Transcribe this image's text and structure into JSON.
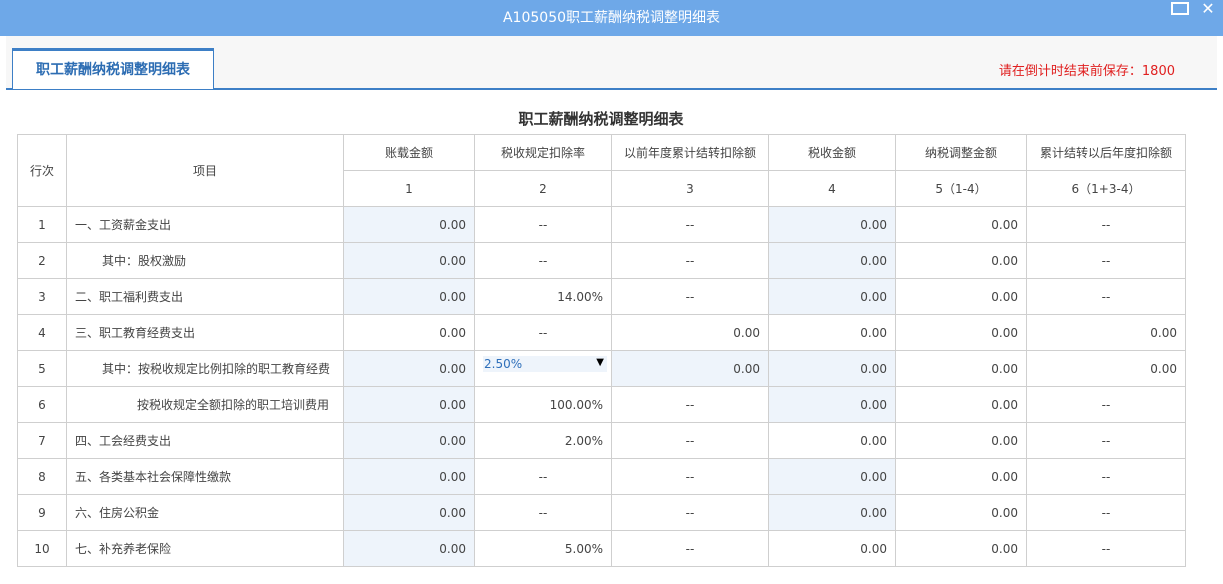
{
  "window": {
    "title": "A105050职工薪酬纳税调整明细表",
    "maximize_icon": "maximize-icon",
    "close_glyph": "✕"
  },
  "tab": {
    "label": "职工薪酬纳税调整明细表"
  },
  "countdown": {
    "text": "请在倒计时结束前保存：1800"
  },
  "sheet": {
    "title": "职工薪酬纳税调整明细表",
    "headers": {
      "row_no": "行次",
      "item": "项目",
      "cols": [
        "账载金额",
        "税收规定扣除率",
        "以前年度累计结转扣除额",
        "税收金额",
        "纳税调整金额",
        "累计结转以后年度扣除额"
      ],
      "col_nums": [
        "1",
        "2",
        "3",
        "4",
        "5（1-4）",
        "6（1+3-4）"
      ]
    },
    "rows": [
      {
        "no": "1",
        "item": "一、工资薪金支出",
        "c1": "0.00",
        "c2": "--",
        "c3": "--",
        "c4": "0.00",
        "c5": "0.00",
        "c6": "--"
      },
      {
        "no": "2",
        "item": "其中：股权激励",
        "c1": "0.00",
        "c2": "--",
        "c3": "--",
        "c4": "0.00",
        "c5": "0.00",
        "c6": "--"
      },
      {
        "no": "3",
        "item": "二、职工福利费支出",
        "c1": "0.00",
        "c2": "14.00%",
        "c3": "--",
        "c4": "0.00",
        "c5": "0.00",
        "c6": "--"
      },
      {
        "no": "4",
        "item": "三、职工教育经费支出",
        "c1": "0.00",
        "c2": "--",
        "c3": "0.00",
        "c4": "0.00",
        "c5": "0.00",
        "c6": "0.00"
      },
      {
        "no": "5",
        "item": "其中：按税收规定比例扣除的职工教育经费",
        "c1": "0.00",
        "c2": "2.50%",
        "c3": "0.00",
        "c4": "0.00",
        "c5": "0.00",
        "c6": "0.00"
      },
      {
        "no": "6",
        "item": "按税收规定全额扣除的职工培训费用",
        "c1": "0.00",
        "c2": "100.00%",
        "c3": "--",
        "c4": "0.00",
        "c5": "0.00",
        "c6": "--"
      },
      {
        "no": "7",
        "item": "四、工会经费支出",
        "c1": "0.00",
        "c2": "2.00%",
        "c3": "--",
        "c4": "0.00",
        "c5": "0.00",
        "c6": "--"
      },
      {
        "no": "8",
        "item": "五、各类基本社会保障性缴款",
        "c1": "0.00",
        "c2": "--",
        "c3": "--",
        "c4": "0.00",
        "c5": "0.00",
        "c6": "--"
      },
      {
        "no": "9",
        "item": "六、住房公积金",
        "c1": "0.00",
        "c2": "--",
        "c3": "--",
        "c4": "0.00",
        "c5": "0.00",
        "c6": "--"
      },
      {
        "no": "10",
        "item": "七、补充养老保险",
        "c1": "0.00",
        "c2": "5.00%",
        "c3": "--",
        "c4": "0.00",
        "c5": "0.00",
        "c6": "--"
      }
    ]
  },
  "colors": {
    "titlebar": "#6ea8e8",
    "accent": "#3d7fc6",
    "editable_bg": "#eef4fb",
    "editable_text": "#2e6fba",
    "countdown": "#e02020"
  }
}
